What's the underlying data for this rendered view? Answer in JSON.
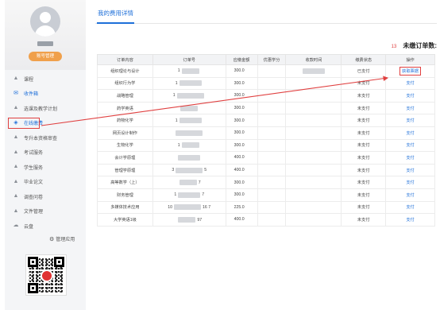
{
  "sidebar": {
    "account_button": "账号管理",
    "items": [
      {
        "label": "课程",
        "icon": "graduation-cap-icon"
      },
      {
        "label": "收件箱",
        "icon": "inbox-icon",
        "active": true
      },
      {
        "label": "选课及教学计划",
        "icon": "graduation-cap-icon"
      },
      {
        "label": "在线缴费",
        "icon": "payment-icon",
        "highlight": true
      },
      {
        "label": "专升本资格审查",
        "icon": "graduation-cap-icon"
      },
      {
        "label": "考试服务",
        "icon": "graduation-cap-icon"
      },
      {
        "label": "学生服务",
        "icon": "graduation-cap-icon"
      },
      {
        "label": "毕业论文",
        "icon": "graduation-cap-icon"
      },
      {
        "label": "调查问卷",
        "icon": "graduation-cap-icon"
      },
      {
        "label": "文件管理",
        "icon": "graduation-cap-icon"
      },
      {
        "label": "云盘",
        "icon": "cloud-icon"
      }
    ],
    "manage_apps": "管理应用"
  },
  "main": {
    "tab_title": "我的费用详情",
    "unpaid_count": "13",
    "unpaid_label": "未缴订单数:"
  },
  "table": {
    "headers": [
      "订单内容",
      "订单号",
      "应缴金额",
      "优惠学分",
      "收款时间",
      "缴费状态",
      "操作"
    ],
    "rows": [
      {
        "content": "组织理论与设计",
        "order_prefix": "1",
        "order_suffix": "",
        "amount": "300.0",
        "credit": "",
        "time": "",
        "status": "已支付",
        "action": "获取票据"
      },
      {
        "content": "组织行为学",
        "order_prefix": "1",
        "order_suffix": "",
        "amount": "300.0",
        "credit": "",
        "time": "",
        "status": "未支付",
        "action": "支付"
      },
      {
        "content": "战略管理",
        "order_prefix": "1",
        "order_suffix": "",
        "amount": "300.0",
        "credit": "",
        "time": "",
        "status": "未支付",
        "action": "支付"
      },
      {
        "content": "药学英语",
        "order_prefix": "",
        "order_suffix": "",
        "amount": "300.0",
        "credit": "",
        "time": "",
        "status": "未支付",
        "action": "支付"
      },
      {
        "content": "药物化学",
        "order_prefix": "1",
        "order_suffix": "",
        "amount": "300.0",
        "credit": "",
        "time": "",
        "status": "未支付",
        "action": "支付"
      },
      {
        "content": "网页设计制作",
        "order_prefix": "",
        "order_suffix": "",
        "amount": "300.0",
        "credit": "",
        "time": "",
        "status": "未支付",
        "action": "支付"
      },
      {
        "content": "生物化学",
        "order_prefix": "1",
        "order_suffix": "",
        "amount": "300.0",
        "credit": "",
        "time": "",
        "status": "未支付",
        "action": "支付"
      },
      {
        "content": "会计学原理",
        "order_prefix": "",
        "order_suffix": "",
        "amount": "400.0",
        "credit": "",
        "time": "",
        "status": "未支付",
        "action": "支付"
      },
      {
        "content": "管理学原理",
        "order_prefix": "3",
        "order_suffix": "5",
        "amount": "400.0",
        "credit": "",
        "time": "",
        "status": "未支付",
        "action": "支付"
      },
      {
        "content": "高等数学（上）",
        "order_prefix": "",
        "order_suffix": "7",
        "amount": "300.0",
        "credit": "",
        "time": "",
        "status": "未支付",
        "action": "支付"
      },
      {
        "content": "财务管理",
        "order_prefix": "1",
        "order_suffix": "7",
        "amount": "300.0",
        "credit": "",
        "time": "",
        "status": "未支付",
        "action": "支付"
      },
      {
        "content": "多媒体技术应用",
        "order_prefix": "10",
        "order_suffix": "16   7",
        "amount": "225.0",
        "credit": "",
        "time": "",
        "status": "未支付",
        "action": "支付"
      },
      {
        "content": "大学英语1级",
        "order_prefix": "",
        "order_suffix": "97",
        "amount": "400.0",
        "credit": "",
        "time": "",
        "status": "未支付",
        "action": "支付"
      }
    ]
  },
  "colors": {
    "accent": "#1e6fd9",
    "highlight": "#e04040",
    "account_button": "#f0a04b"
  }
}
